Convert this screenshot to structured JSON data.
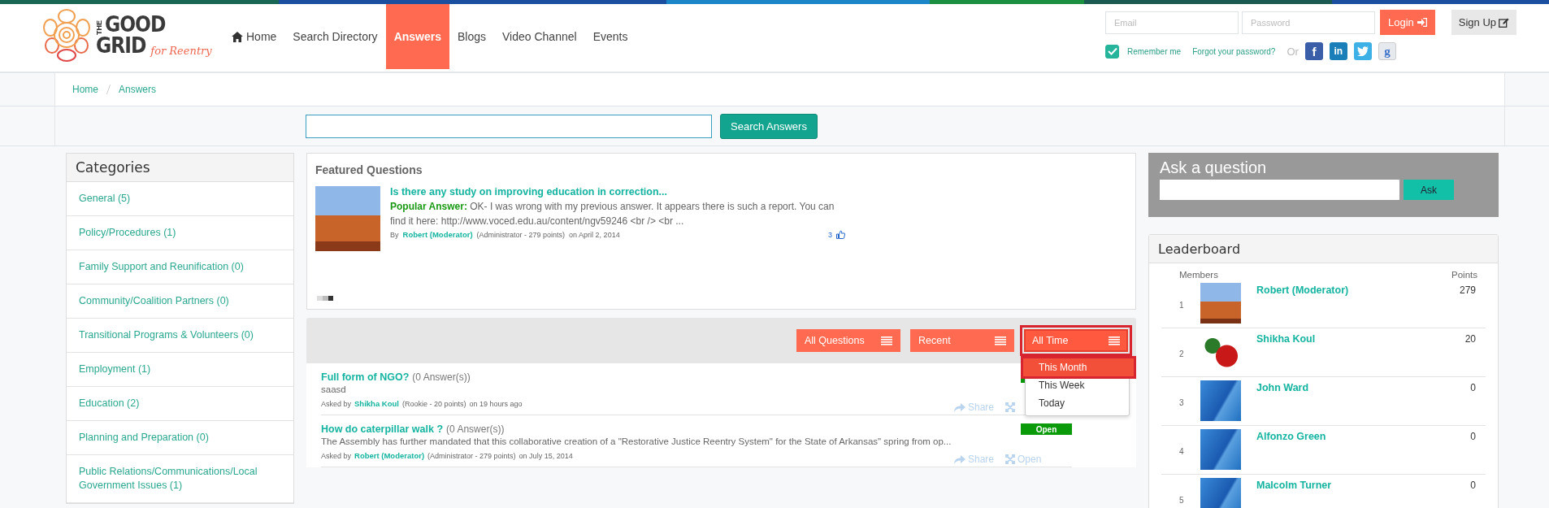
{
  "logo": {
    "small": "THE",
    "big1": "GOOD",
    "big2": "GRID",
    "tagline": "for Reentry"
  },
  "nav": [
    {
      "label": "Home",
      "kind": "home",
      "selected": false
    },
    {
      "label": "Search Directory",
      "selected": false
    },
    {
      "label": "Answers",
      "selected": true
    },
    {
      "label": "Blogs",
      "selected": false
    },
    {
      "label": "Video Channel",
      "selected": false
    },
    {
      "label": "Events",
      "selected": false
    }
  ],
  "login": {
    "email_placeholder": "Email",
    "password_placeholder": "Password",
    "login_button": "Login",
    "signup_button": "Sign Up",
    "remember_me": "Remember me",
    "remember_checked": true,
    "forgot": "Forgot your password?",
    "or": "Or",
    "social": [
      {
        "kind": "facebook",
        "glyph": "f"
      },
      {
        "kind": "linkedin",
        "glyph": "in"
      },
      {
        "kind": "twitter"
      },
      {
        "kind": "google",
        "glyph": "g"
      }
    ]
  },
  "breadcrumb": [
    "Home",
    "Answers"
  ],
  "search": {
    "button": "Search Answers"
  },
  "categories": {
    "title": "Categories",
    "items": [
      "General (5)",
      "Policy/Procedures (1)",
      "Family Support and Reunification (0)",
      "Community/Coalition Partners (0)",
      "Transitional Programs & Volunteers (0)",
      "Employment (1)",
      "Education (2)",
      "Planning and Preparation (0)",
      "Public Relations/Communications/Local Government Issues (1)"
    ]
  },
  "featured": {
    "title": "Featured Questions",
    "question": "Is there any study on improving education in correction...",
    "answer_label": "Popular Answer:",
    "answer": "OK- I was wrong with my previous answer. It appears there is such a report. You can find it here: http://www.voced.edu.au/content/ngv59246 <br /> <br ...",
    "by": "By",
    "author": "Robert (Moderator)",
    "role": "(Administrator - 279 points)",
    "date": "on April 2, 2014",
    "likes": "3"
  },
  "filters": [
    {
      "label": "All Questions",
      "open": false
    },
    {
      "label": "Recent",
      "open": false
    },
    {
      "label": "All Time",
      "open": true,
      "menu": [
        {
          "label": "This Month",
          "selected": true
        },
        {
          "label": "This Week",
          "selected": false
        },
        {
          "label": "Today",
          "selected": false
        }
      ]
    }
  ],
  "questions": [
    {
      "title": "Full form of NGO?",
      "answers": "(0 Answer(s))",
      "body": "saasd",
      "asked_by": "Asked by",
      "author": "Shikha Koul",
      "role": "(Rookie - 20 points)",
      "date": "on 19 hours ago",
      "status": {
        "kind": "open"
      },
      "share": "Share"
    },
    {
      "title": "How do caterpillar walk ?",
      "answers": "(0 Answer(s))",
      "body": "The Assembly has further mandated that this collaborative creation of a \"Restorative Justice Reentry System\" for the State of Arkansas\" spring from op...",
      "asked_by": "Asked by",
      "author": "Robert (Moderator)",
      "role": "(Administrator - 279 points)",
      "date": "on July 15, 2014",
      "status": {
        "kind": "open",
        "label": "Open"
      },
      "share": "Share",
      "open": "Open"
    }
  ],
  "ask": {
    "title": "Ask a question",
    "button": "Ask"
  },
  "leaderboard": {
    "title": "Leaderboard",
    "members_label": "Members",
    "points_label": "Points",
    "rows": [
      {
        "rank": "1",
        "name": "Robert (Moderator)",
        "points": "279",
        "kind": "rock"
      },
      {
        "rank": "2",
        "name": "Shikha Koul",
        "points": "20",
        "kind": "rose"
      },
      {
        "rank": "3",
        "name": "John Ward",
        "points": "0",
        "kind": "default"
      },
      {
        "rank": "4",
        "name": "Alfonzo Green",
        "points": "0",
        "kind": "default"
      },
      {
        "rank": "5",
        "name": "Malcolm Turner",
        "points": "0",
        "kind": "default"
      }
    ]
  }
}
